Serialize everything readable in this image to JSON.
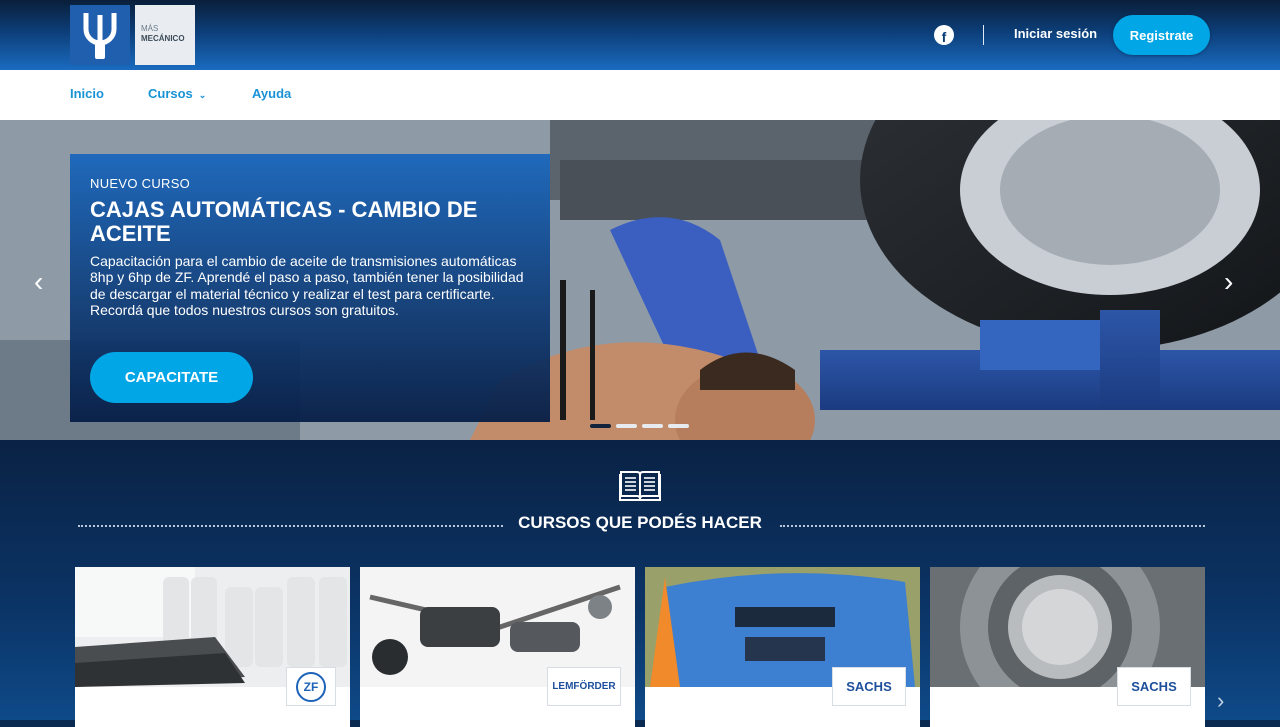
{
  "header": {
    "logo_line1": "MÁS",
    "logo_line2": "MECÁNICO",
    "login_label": "Iniciar sesión",
    "register_label": "Registrate"
  },
  "nav": {
    "items": [
      {
        "label": "Inicio"
      },
      {
        "label": "Cursos"
      },
      {
        "label": "Ayuda"
      }
    ]
  },
  "hero": {
    "kicker": "NUEVO CURSO",
    "title": "CAJAS AUTOMÁTICAS - CAMBIO DE ACEITE",
    "description": "Capacitación para el cambio de aceite de transmisiones automáticas 8hp y 6hp de ZF. Aprendé el paso a paso, también tener la posibilidad de descargar el material técnico y realizar el test para certificarte. Recordá que todos nuestros cursos son gratuitos.",
    "cta_label": "CAPACITATE",
    "slides_total": 4,
    "active_slide": 1
  },
  "courses": {
    "title": "CURSOS QUE PODÉS HACER",
    "cards": [
      {
        "brand": "ZF"
      },
      {
        "brand": "LEMFÖRDER"
      },
      {
        "brand": "SACHS"
      },
      {
        "brand": "SACHS"
      }
    ]
  },
  "colors": {
    "accent": "#00a6e6",
    "nav_link": "#1a93d6",
    "header_dark": "#0a1e3a",
    "header_light": "#1a6bc0"
  }
}
